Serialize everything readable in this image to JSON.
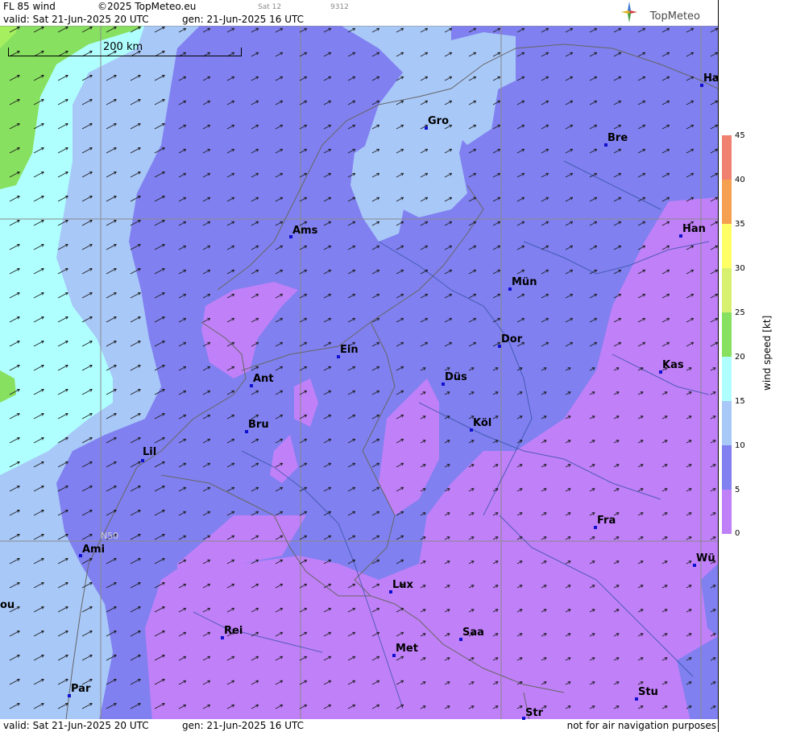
{
  "header": {
    "product": "FL 85 wind",
    "copyright": "©2025 TopMeteo.eu",
    "sat": "Sat 12",
    "code": "9312",
    "valid": "valid:  Sat  21-Jun-2025  20 UTC",
    "gen": "gen: 21-Jun-2025 16 UTC",
    "brand": "TopMeteo"
  },
  "footer": {
    "valid": "valid:  Sat  21-Jun-2025  20 UTC",
    "gen": "gen: 21-Jun-2025 16 UTC",
    "disclaimer": "not for air navigation purposes"
  },
  "map": {
    "scale_label": "200 km",
    "lat_label": "N50",
    "cities": [
      {
        "id": "ha",
        "label": "Ha"
      },
      {
        "id": "gro",
        "label": "Gro"
      },
      {
        "id": "bre",
        "label": "Bre"
      },
      {
        "id": "ams",
        "label": "Ams"
      },
      {
        "id": "han",
        "label": "Han"
      },
      {
        "id": "mun",
        "label": "Mün"
      },
      {
        "id": "ein",
        "label": "Ein"
      },
      {
        "id": "dor",
        "label": "Dor"
      },
      {
        "id": "ant",
        "label": "Ant"
      },
      {
        "id": "dus",
        "label": "Düs"
      },
      {
        "id": "kas",
        "label": "Kas"
      },
      {
        "id": "bru",
        "label": "Bru"
      },
      {
        "id": "kol",
        "label": "Köl"
      },
      {
        "id": "lil",
        "label": "Lil"
      },
      {
        "id": "fra",
        "label": "Fra"
      },
      {
        "id": "ami",
        "label": "Ami"
      },
      {
        "id": "wu",
        "label": "Wü"
      },
      {
        "id": "lux",
        "label": "Lux"
      },
      {
        "id": "ou",
        "label": "ou"
      },
      {
        "id": "rei",
        "label": "Rei"
      },
      {
        "id": "saa",
        "label": "Saa"
      },
      {
        "id": "met",
        "label": "Met"
      },
      {
        "id": "stu",
        "label": "Stu"
      },
      {
        "id": "par",
        "label": "Par"
      },
      {
        "id": "str",
        "label": "Str"
      }
    ]
  },
  "legend": {
    "unit": "wind speed [kt]",
    "ticks": [
      "45",
      "40",
      "35",
      "30",
      "25",
      "20",
      "15",
      "10",
      "5",
      "0"
    ],
    "colors": [
      "#f08070",
      "#f5a050",
      "#f8d040",
      "#ffff66",
      "#d8f070",
      "#88e060",
      "#50e080",
      "#b0ffff",
      "#a8c8f8",
      "#8080f0",
      "#c080f8"
    ]
  }
}
